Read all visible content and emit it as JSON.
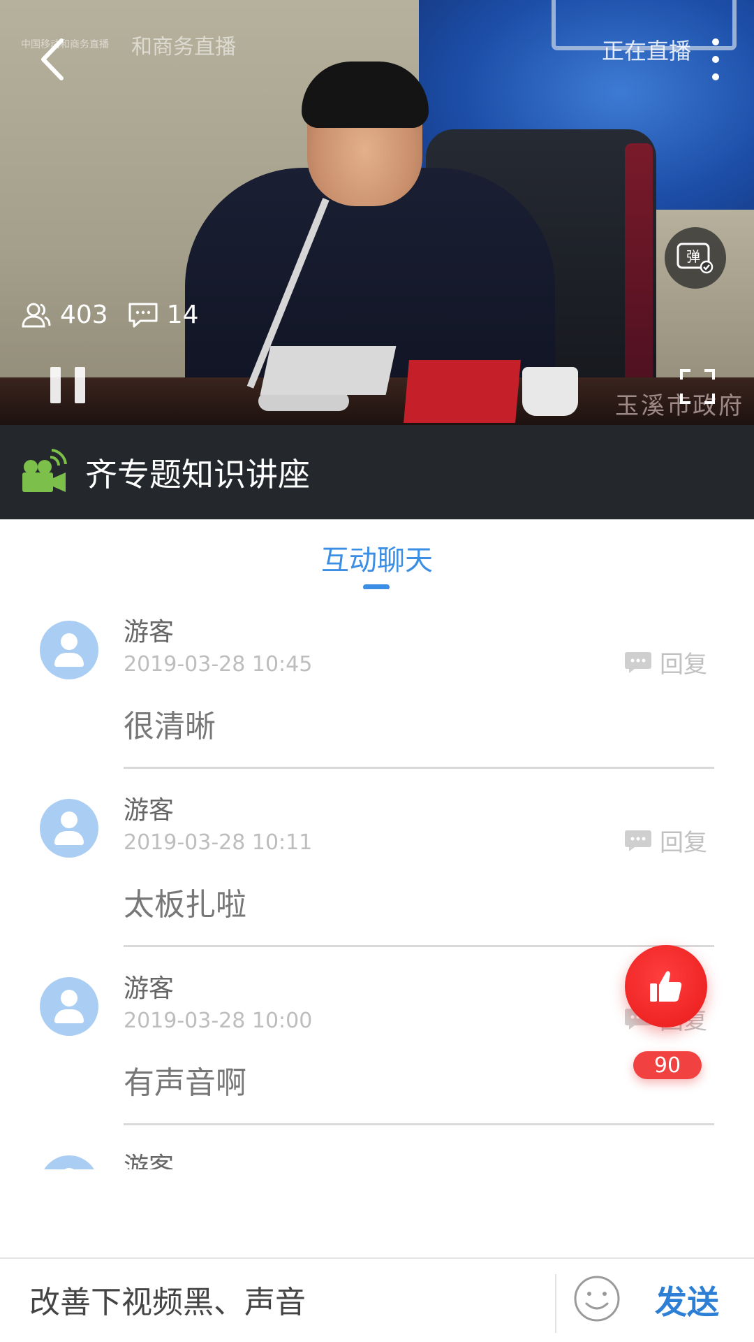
{
  "video": {
    "watermark_line1": "中国移动和商务直播",
    "watermark_line2": "和商务直播",
    "live_status": "正在直播",
    "gov_watermark": "玉溪市政府",
    "danmaku_label": "弹",
    "viewer_count": "403",
    "comment_count": "14",
    "icons": [
      "back-arrow-icon",
      "more-vertical-icon",
      "danmaku-icon",
      "viewers-icon",
      "comments-icon",
      "pause-icon",
      "fullscreen-icon"
    ]
  },
  "title": {
    "text": "齐专题知识讲座",
    "icon": "video-camera-icon",
    "icon_color": "#7cc04b"
  },
  "tab": {
    "label": "互动聊天",
    "accent": "#3b8ee4"
  },
  "messages": [
    {
      "user": "游客",
      "time": "2019-03-28 10:45",
      "text": "很清晰",
      "reply_label": "回复"
    },
    {
      "user": "游客",
      "time": "2019-03-28 10:11",
      "text": "太板扎啦",
      "reply_label": "回复"
    },
    {
      "user": "游客",
      "time": "2019-03-28 10:00",
      "text": "有声音啊",
      "reply_label": "回复"
    },
    {
      "user": "游客",
      "time": "",
      "text": "",
      "reply_label": ""
    }
  ],
  "like": {
    "count": "90",
    "color": "#f02d2d"
  },
  "input": {
    "value": "改善下视频黑、声音",
    "send_label": "发送"
  }
}
